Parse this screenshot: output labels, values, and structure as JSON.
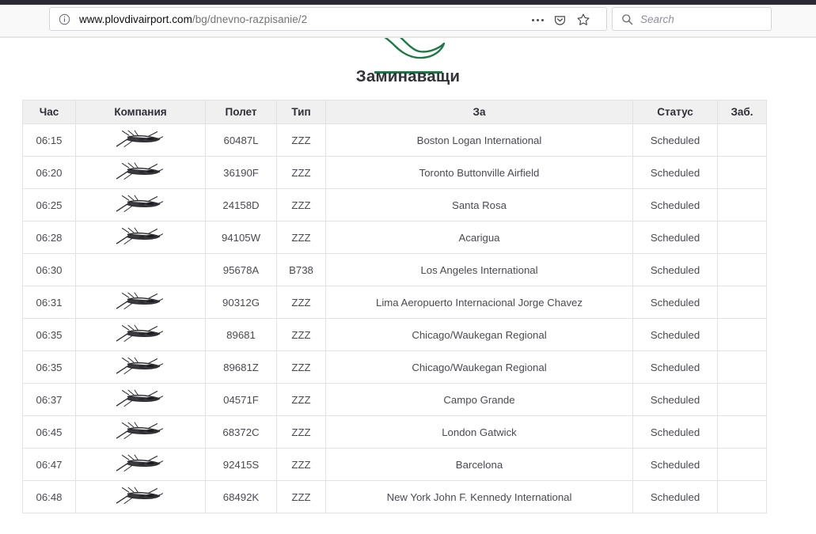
{
  "browser": {
    "identity_icon": "info-circle-icon",
    "url_host": "www.plovdivairport.com",
    "url_path": "/bg/dnevno-razpisanie/2",
    "page_actions_icon": "ellipsis-icon",
    "pocket_icon": "pocket-icon",
    "bookmark_icon": "star-icon",
    "search_icon": "search-icon",
    "search_placeholder": "Search"
  },
  "page": {
    "brand_icon": "airplane-outline-icon",
    "title": "Заминаващи",
    "accent_color": "#1e7a45",
    "header_bg": "#f0f0f0",
    "border_color": "#e2e2e4"
  },
  "table": {
    "columns": [
      {
        "key": "time",
        "label": "Час"
      },
      {
        "key": "company",
        "label": "Компания"
      },
      {
        "key": "flight",
        "label": "Полет"
      },
      {
        "key": "type",
        "label": "Тип"
      },
      {
        "key": "dest",
        "label": "За"
      },
      {
        "key": "status",
        "label": "Статус"
      },
      {
        "key": "note",
        "label": "Заб."
      }
    ],
    "rows": [
      {
        "time": "06:15",
        "company_icon": "airline-logo-plane-sketch",
        "flight": "60487L",
        "type": "ZZZ",
        "dest": "Boston Logan International",
        "status": "Scheduled",
        "note": ""
      },
      {
        "time": "06:20",
        "company_icon": "airline-logo-plane-sketch",
        "flight": "36190F",
        "type": "ZZZ",
        "dest": "Toronto Buttonville Airfield",
        "status": "Scheduled",
        "note": ""
      },
      {
        "time": "06:25",
        "company_icon": "airline-logo-plane-sketch",
        "flight": "24158D",
        "type": "ZZZ",
        "dest": "Santa Rosa",
        "status": "Scheduled",
        "note": ""
      },
      {
        "time": "06:28",
        "company_icon": "airline-logo-plane-sketch",
        "flight": "94105W",
        "type": "ZZZ",
        "dest": "Acarigua",
        "status": "Scheduled",
        "note": ""
      },
      {
        "time": "06:30",
        "company_icon": "",
        "flight": "95678A",
        "type": "B738",
        "dest": "Los Angeles International",
        "status": "Scheduled",
        "note": ""
      },
      {
        "time": "06:31",
        "company_icon": "airline-logo-plane-sketch",
        "flight": "90312G",
        "type": "ZZZ",
        "dest": "Lima Aeropuerto Internacional Jorge Chavez",
        "status": "Scheduled",
        "note": ""
      },
      {
        "time": "06:35",
        "company_icon": "airline-logo-plane-sketch",
        "flight": "89681",
        "type": "ZZZ",
        "dest": "Chicago/Waukegan Regional",
        "status": "Scheduled",
        "note": ""
      },
      {
        "time": "06:35",
        "company_icon": "airline-logo-plane-sketch",
        "flight": "89681Z",
        "type": "ZZZ",
        "dest": "Chicago/Waukegan Regional",
        "status": "Scheduled",
        "note": ""
      },
      {
        "time": "06:37",
        "company_icon": "airline-logo-plane-sketch",
        "flight": "04571F",
        "type": "ZZZ",
        "dest": "Campo Grande",
        "status": "Scheduled",
        "note": ""
      },
      {
        "time": "06:45",
        "company_icon": "airline-logo-plane-sketch",
        "flight": "68372C",
        "type": "ZZZ",
        "dest": "London Gatwick",
        "status": "Scheduled",
        "note": ""
      },
      {
        "time": "06:47",
        "company_icon": "airline-logo-plane-sketch",
        "flight": "92415S",
        "type": "ZZZ",
        "dest": "Barcelona",
        "status": "Scheduled",
        "note": ""
      },
      {
        "time": "06:48",
        "company_icon": "airline-logo-plane-sketch",
        "flight": "68492K",
        "type": "ZZZ",
        "dest": "New York John F. Kennedy International",
        "status": "Scheduled",
        "note": ""
      }
    ]
  }
}
